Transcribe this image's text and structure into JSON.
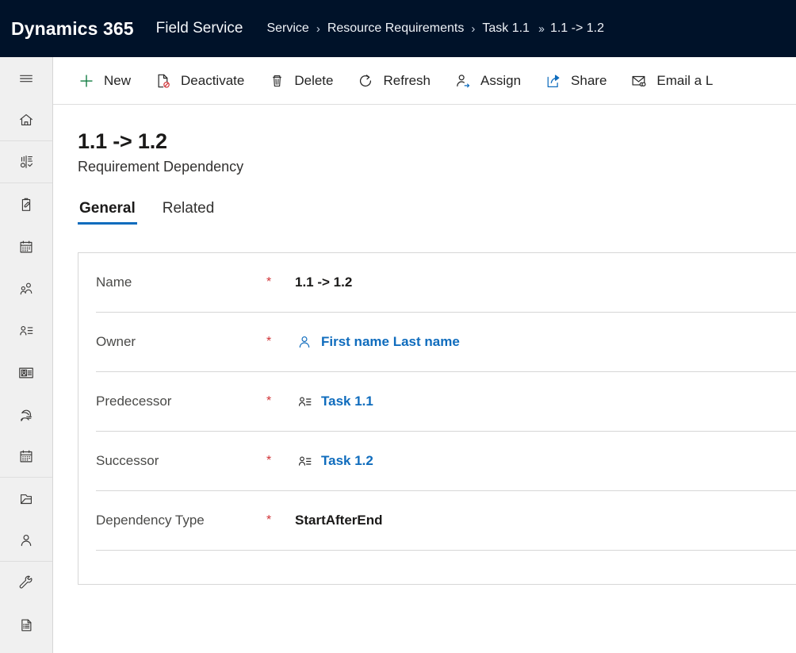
{
  "header": {
    "brand": "Dynamics 365",
    "app_name": "Field Service",
    "background_color": "#001229",
    "breadcrumb": [
      {
        "label": "Service",
        "separator": "single"
      },
      {
        "label": "Resource Requirements",
        "separator": "single"
      },
      {
        "label": "Task 1.1",
        "separator": "double"
      },
      {
        "label": "1.1 -> 1.2",
        "separator": "none"
      }
    ]
  },
  "sidebar": {
    "items": [
      {
        "name": "site-map-toggle",
        "icon": "hamburger-menu-icon",
        "group_end": false
      },
      {
        "name": "home",
        "icon": "home-icon",
        "group_end": true
      },
      {
        "name": "dashboards",
        "icon": "dashboard-chart-icon",
        "group_end": true
      },
      {
        "name": "activities",
        "icon": "clipboard-pencil-icon",
        "group_end": false
      },
      {
        "name": "schedule-board",
        "icon": "calendar-icon",
        "group_end": false
      },
      {
        "name": "accounts",
        "icon": "people-group-icon",
        "group_end": false
      },
      {
        "name": "contacts",
        "icon": "contact-list-icon",
        "group_end": false
      },
      {
        "name": "resources",
        "icon": "id-card-icon",
        "group_end": false
      },
      {
        "name": "work-orders",
        "icon": "service-task-icon",
        "group_end": false
      },
      {
        "name": "bookings",
        "icon": "calendar-month-icon",
        "group_end": true
      },
      {
        "name": "projects",
        "icon": "folder-icon",
        "group_end": false
      },
      {
        "name": "users",
        "icon": "person-icon",
        "group_end": true
      },
      {
        "name": "settings",
        "icon": "wrench-icon",
        "group_end": false
      },
      {
        "name": "reports",
        "icon": "document-list-icon",
        "group_end": false
      }
    ]
  },
  "command_bar": {
    "buttons": [
      {
        "label": "New",
        "icon": "plus-icon",
        "accent": "#107c41"
      },
      {
        "label": "Deactivate",
        "icon": "deactivate-document-icon",
        "accent": "#d13438"
      },
      {
        "label": "Delete",
        "icon": "trash-icon",
        "accent": "#242424"
      },
      {
        "label": "Refresh",
        "icon": "refresh-icon",
        "accent": "#242424"
      },
      {
        "label": "Assign",
        "icon": "assign-person-icon",
        "accent": "#0f6cbd"
      },
      {
        "label": "Share",
        "icon": "share-icon",
        "accent": "#0f6cbd"
      },
      {
        "label": "Email a L",
        "icon": "email-link-icon",
        "accent": "#242424"
      }
    ]
  },
  "record": {
    "title": "1.1 -> 1.2",
    "subtitle": "Requirement Dependency",
    "tabs": [
      {
        "label": "General",
        "active": true
      },
      {
        "label": "Related",
        "active": false
      }
    ],
    "required_marker": "*",
    "fields": [
      {
        "label": "Name",
        "required": true,
        "value": "1.1 -> 1.2",
        "kind": "text",
        "icon": ""
      },
      {
        "label": "Owner",
        "required": true,
        "value": "First name Last name",
        "kind": "link",
        "icon": "person-icon"
      },
      {
        "label": "Predecessor",
        "required": true,
        "value": "Task 1.1",
        "kind": "link",
        "icon": "requirement-icon"
      },
      {
        "label": "Successor",
        "required": true,
        "value": "Task 1.2",
        "kind": "link",
        "icon": "requirement-icon"
      },
      {
        "label": "Dependency Type",
        "required": true,
        "value": "StartAfterEnd",
        "kind": "text",
        "icon": ""
      }
    ]
  },
  "colors": {
    "link": "#0f6cbd",
    "required": "#d13438",
    "tab_underline": "#0f6cbd",
    "header_bg": "#001229",
    "sidebar_bg": "#f0f0f0"
  }
}
